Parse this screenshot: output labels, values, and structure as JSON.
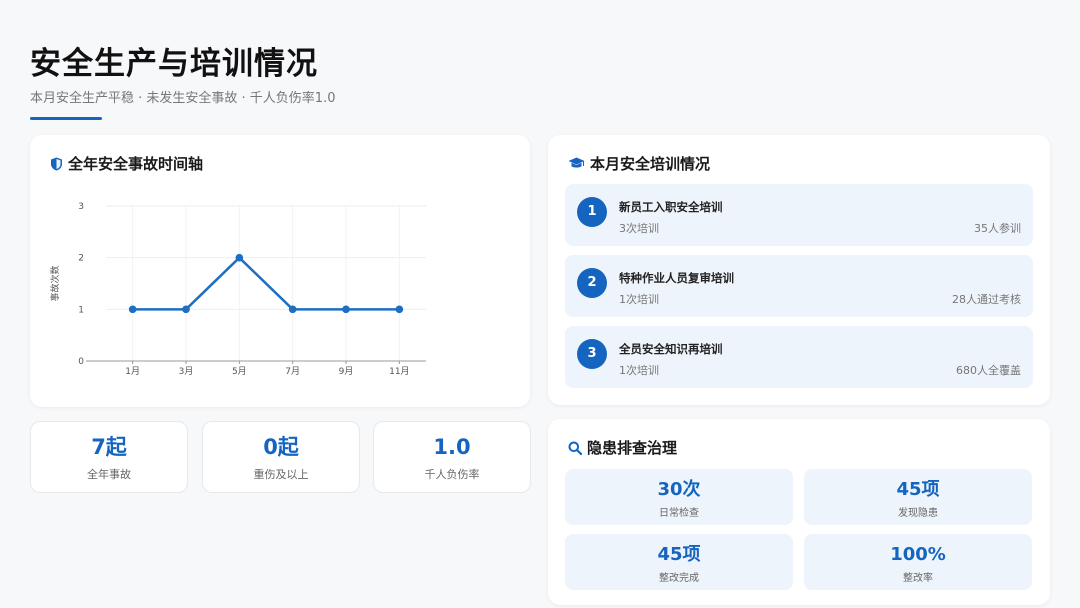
{
  "header": {
    "title": "安全生产与培训情况",
    "subtitle": "本月安全生产平稳 · 未发生安全事故 · 千人负伤率1.0"
  },
  "accident_card": {
    "title": "全年安全事故时间轴",
    "icon": "shield-icon"
  },
  "chart_data": {
    "type": "line",
    "title": "全年安全事故时间轴",
    "x": [
      "1月",
      "3月",
      "5月",
      "7月",
      "9月",
      "11月"
    ],
    "series": [
      {
        "values": [
          1,
          1,
          2,
          1,
          1,
          1
        ]
      }
    ],
    "xlabel": "",
    "ylabel": "事故次数",
    "ylim": [
      0,
      3
    ],
    "yticks": [
      "0",
      "1",
      "2",
      "3"
    ],
    "grid": true,
    "color": "#1e6fc2"
  },
  "stats": [
    {
      "value": "7起",
      "label": "全年事故"
    },
    {
      "value": "0起",
      "label": "重伤及以上"
    },
    {
      "value": "1.0",
      "label": "千人负伤率"
    }
  ],
  "training": {
    "title": "本月安全培训情况",
    "icon": "graduation-cap-icon",
    "items": [
      {
        "num": "1",
        "name": "新员工入职安全培训",
        "count": "3次培训",
        "meta": "35人参训"
      },
      {
        "num": "2",
        "name": "特种作业人员复审培训",
        "count": "1次培训",
        "meta": "28人通过考核"
      },
      {
        "num": "3",
        "name": "全员安全知识再培训",
        "count": "1次培训",
        "meta": "680人全覆盖"
      }
    ]
  },
  "hazard": {
    "title": "隐患排查治理",
    "icon": "search-icon",
    "items": [
      {
        "value": "30次",
        "label": "日常检查"
      },
      {
        "value": "45项",
        "label": "发现隐患"
      },
      {
        "value": "45项",
        "label": "整改完成"
      },
      {
        "value": "100%",
        "label": "整改率"
      }
    ]
  },
  "colors": {
    "accent": "#1565c0",
    "tile_bg": "#eef4fb",
    "background": "#f7f8fa"
  }
}
